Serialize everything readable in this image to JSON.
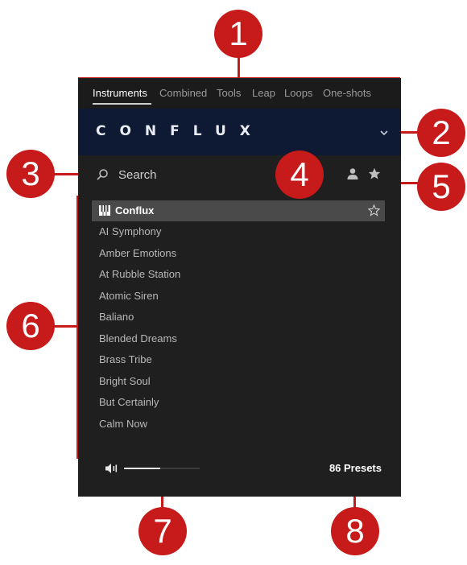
{
  "tabs": [
    "Instruments",
    "Combined",
    "Tools",
    "Leap",
    "Loops",
    "One-shots"
  ],
  "active_tab": "Instruments",
  "banner": {
    "brand": "CONFLUX",
    "chevron_icon": "chevron-down-icon"
  },
  "search": {
    "placeholder": "Search",
    "icon": "search-icon"
  },
  "filters": {
    "user_icon": "user-icon",
    "favorites_icon": "star-icon"
  },
  "presets": {
    "selected_index": 0,
    "items": [
      "Conflux",
      "AI Symphony",
      "Amber Emotions",
      "At Rubble Station",
      "Atomic Siren",
      "Baliano",
      "Blended Dreams",
      "Brass Tribe",
      "Bright Soul",
      "But Certainly",
      "Calm Now"
    ]
  },
  "footer": {
    "volume_level": 0.48,
    "preset_count": "86 Presets"
  },
  "callouts": [
    "1",
    "2",
    "3",
    "4",
    "5",
    "6",
    "7",
    "8"
  ],
  "colors": {
    "callout": "#c71a1a",
    "panel": "#1f1f1f",
    "banner": "#0e1a33",
    "selected_row": "#4a4a4a"
  }
}
